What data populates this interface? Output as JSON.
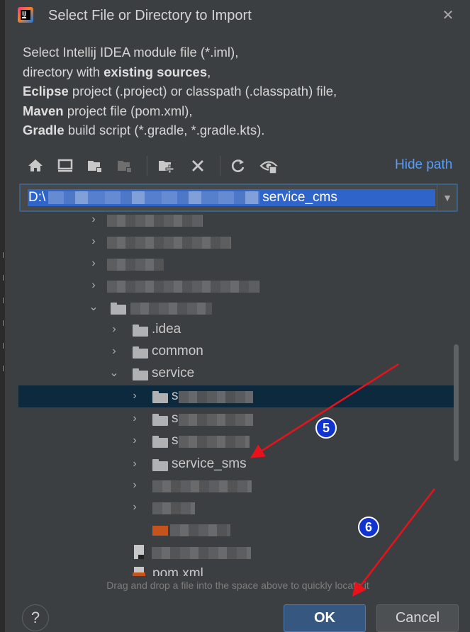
{
  "window": {
    "title": "Select File or Directory to Import",
    "close_glyph": "✕"
  },
  "description": {
    "line1_text": "Select Intellij IDEA module file (*.iml),",
    "line2_pre": "directory with ",
    "line2_bold": "existing sources",
    "line2_post": ",",
    "line3_bold": "Eclipse",
    "line3_post": " project (.project) or classpath (.classpath) file,",
    "line4_bold": "Maven",
    "line4_post": " project file (pom.xml),",
    "line5_bold": "Gradle",
    "line5_post": " build script (*.gradle, *.gradle.kts)."
  },
  "toolbar": {
    "buttons": [
      "home-icon",
      "desktop-icon",
      "project-folder-icon",
      "module-folder-icon",
      "new-folder-icon",
      "delete-icon",
      "refresh-icon",
      "show-hidden-icon"
    ],
    "hide_path_label": "Hide path"
  },
  "path": {
    "prefix": "D:\\",
    "suffix": "service_cms"
  },
  "tree": {
    "chevron_right": "›",
    "chevron_down": "⌄",
    "labels": {
      "idea": ".idea",
      "common": "common",
      "service": "service",
      "service_sms": "service_sms",
      "pom": "pom.xml",
      "s": "s"
    }
  },
  "hint": "Drag and drop a file into the space above to quickly locate it",
  "buttons": {
    "help": "?",
    "ok": "OK",
    "cancel": "Cancel"
  },
  "annotations": {
    "step5": "5",
    "step6": "6",
    "arrow_color": "#e8121b"
  },
  "colors": {
    "selection": "#0d293e",
    "path_highlight": "#2f65ca",
    "link": "#589df6",
    "ok_button": "#365880"
  }
}
